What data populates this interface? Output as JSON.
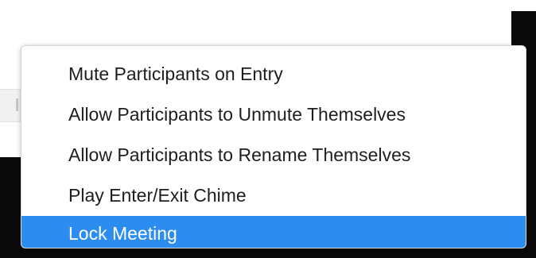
{
  "menu": {
    "items": [
      {
        "label": "Mute Participants on Entry"
      },
      {
        "label": "Allow Participants to Unmute Themselves"
      },
      {
        "label": "Allow Participants to Rename Themselves"
      },
      {
        "label": "Play Enter/Exit Chime"
      },
      {
        "label": "Lock Meeting"
      }
    ],
    "highlighted_index": 4
  },
  "colors": {
    "highlight": "#2D8CF0",
    "menu_background": "#FFFFFF",
    "text": "#1E1E1E",
    "backdrop_dark": "#0A0A0A"
  }
}
